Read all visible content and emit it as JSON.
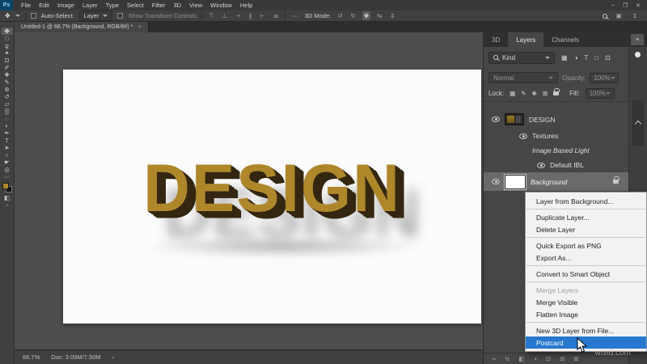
{
  "colors": {
    "accent": "#2878cf",
    "gold": "#ae872b",
    "gold_dark": "#342711"
  },
  "menubar": {
    "logo_text": "Ps",
    "items": [
      "File",
      "Edit",
      "Image",
      "Layer",
      "Type",
      "Select",
      "Filter",
      "3D",
      "View",
      "Window",
      "Help"
    ],
    "minimize": "–",
    "restore": "❐",
    "close": "✕"
  },
  "optionsbar": {
    "move_tool_glyph": "✥",
    "auto_select_label": "Auto-Select:",
    "auto_select_value": "Layer",
    "show_transform_label": "Show Transform Controls",
    "more_glyph": "⋯",
    "mode_label": "3D Mode:",
    "align_icons": [
      {
        "name": "align-top-icon",
        "glyph": "⊤"
      },
      {
        "name": "align-bottom-icon",
        "glyph": "⊥"
      },
      {
        "name": "align-left-icon",
        "glyph": "⊣"
      },
      {
        "name": "align-center-icon",
        "glyph": "∥"
      },
      {
        "name": "align-right-icon",
        "glyph": "⊢"
      },
      {
        "name": "distribute-icon",
        "glyph": "≣"
      }
    ],
    "mode_icons": [
      {
        "name": "3d-rotate-icon",
        "glyph": "↺",
        "active": false
      },
      {
        "name": "3d-roll-icon",
        "glyph": "↻",
        "active": false
      },
      {
        "name": "3d-drag-icon",
        "glyph": "✥",
        "active": true
      },
      {
        "name": "3d-slide-icon",
        "glyph": "⇆",
        "active": false
      },
      {
        "name": "3d-scale-icon",
        "glyph": "⇕",
        "active": false
      }
    ],
    "search_icon": "search-icon",
    "share_glyph": "↥",
    "workspace_glyph": "▣"
  },
  "tabbar": {
    "doc_title": "Untitled-1 @ 66.7% (Background, RGB/8#) *",
    "close_glyph": "✕"
  },
  "toolbar": {
    "tools": [
      {
        "name": "move-tool",
        "glyph": "✥",
        "active": true
      },
      {
        "name": "marquee-tool",
        "glyph": "□",
        "active": false
      },
      {
        "name": "lasso-tool",
        "glyph": "ϱ",
        "active": false
      },
      {
        "name": "quick-selection-tool",
        "glyph": "✦",
        "active": false
      },
      {
        "name": "crop-tool",
        "glyph": "⊡",
        "active": false
      },
      {
        "name": "eyedropper-tool",
        "glyph": "✐",
        "active": false
      },
      {
        "name": "healing-brush-tool",
        "glyph": "✚",
        "active": false
      },
      {
        "name": "brush-tool",
        "glyph": "✎",
        "active": false
      },
      {
        "name": "clone-stamp-tool",
        "glyph": "⊕",
        "active": false
      },
      {
        "name": "history-brush-tool",
        "glyph": "↺",
        "active": false
      },
      {
        "name": "eraser-tool",
        "glyph": "▱",
        "active": false
      },
      {
        "name": "gradient-tool",
        "glyph": "▒",
        "active": false
      },
      {
        "name": "blur-tool",
        "glyph": "◌",
        "active": false
      },
      {
        "name": "dodge-tool",
        "glyph": "◐",
        "active": false
      },
      {
        "name": "pen-tool",
        "glyph": "✒",
        "active": false
      },
      {
        "name": "type-tool",
        "glyph": "T",
        "active": false
      },
      {
        "name": "path-selection-tool",
        "glyph": "➤",
        "active": false
      },
      {
        "name": "shape-tool",
        "glyph": "○",
        "active": false
      },
      {
        "name": "hand-tool",
        "glyph": "☛",
        "active": false
      },
      {
        "name": "zoom-tool",
        "glyph": "◎",
        "active": false
      },
      {
        "name": "edit-toolbar-icon",
        "glyph": "⋯",
        "active": false
      }
    ],
    "mask_glyph": "◧",
    "screen_mode_glyph": "▫"
  },
  "canvas": {
    "text": "DESIGN"
  },
  "statusbar": {
    "zoom": "66.7%",
    "doc": "Doc: 3.09M/7.50M",
    "arrow": "›"
  },
  "layers_panel": {
    "tabs": [
      {
        "label": "3D",
        "active": false
      },
      {
        "label": "Layers",
        "active": true
      },
      {
        "label": "Channels",
        "active": false
      }
    ],
    "menu_glyph": "≡",
    "kind_label": "Kind",
    "filter_icons": [
      {
        "name": "filter-pixel-layers-icon",
        "glyph": "▦"
      },
      {
        "name": "filter-adjustment-layers-icon",
        "glyph": "◑"
      },
      {
        "name": "filter-type-layers-icon",
        "glyph": "T"
      },
      {
        "name": "filter-shape-layers-icon",
        "glyph": "□"
      },
      {
        "name": "filter-smart-objects-icon",
        "glyph": "⊡"
      }
    ],
    "blend_mode": "Normal",
    "opacity_label": "Opacity:",
    "opacity_value": "100%",
    "lock_label": "Lock:",
    "lock_icons": [
      {
        "name": "lock-transparency-icon",
        "glyph": "▦"
      },
      {
        "name": "lock-paint-icon",
        "glyph": "✎"
      },
      {
        "name": "lock-position-icon",
        "glyph": "✥"
      },
      {
        "name": "lock-artboard-icon",
        "glyph": "⊞"
      }
    ],
    "fill_label": "Fill:",
    "fill_value": "100%",
    "rows": [
      {
        "label": "DESIGN",
        "eye": true,
        "thumb": "design",
        "indent": 0,
        "big": true
      },
      {
        "label": "Textures",
        "eye": true,
        "indent": 1
      },
      {
        "label": "Image Based Light",
        "italic": true,
        "indent": 2
      },
      {
        "label": "Default IBL",
        "eye": true,
        "indent": 3
      },
      {
        "label": "Background",
        "italic": true,
        "eye": true,
        "thumb": "background",
        "indent": 0,
        "selected": true,
        "locked": true,
        "big": true
      }
    ],
    "bottom_icons": [
      {
        "name": "link-layers-icon",
        "glyph": "∞"
      },
      {
        "name": "layer-effects-icon",
        "glyph": "fx"
      },
      {
        "name": "layer-mask-icon",
        "glyph": "◧"
      },
      {
        "name": "adjustment-layer-icon",
        "glyph": "◑"
      },
      {
        "name": "layer-group-icon",
        "glyph": "⊟"
      },
      {
        "name": "new-layer-icon",
        "glyph": "⊞"
      },
      {
        "name": "delete-layer-icon",
        "glyph": "⊠"
      }
    ]
  },
  "context_menu": {
    "items": [
      {
        "label": "Layer from Background...",
        "sep_after": true
      },
      {
        "label": "Duplicate Layer..."
      },
      {
        "label": "Delete Layer",
        "sep_after": true
      },
      {
        "label": "Quick Export as PNG"
      },
      {
        "label": "Export As...",
        "sep_after": true
      },
      {
        "label": "Convert to Smart Object",
        "sep_after": true
      },
      {
        "label": "Merge Layers",
        "disabled": true
      },
      {
        "label": "Merge Visible"
      },
      {
        "label": "Flatten Image",
        "sep_after": true
      },
      {
        "label": "New 3D Layer from File..."
      },
      {
        "label": "Postcard",
        "highlighted": true
      }
    ]
  },
  "watermark": "wtvid.com"
}
